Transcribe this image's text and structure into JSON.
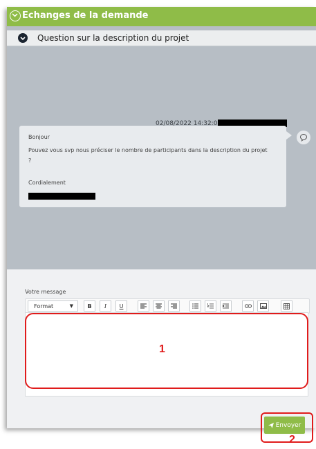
{
  "header": {
    "title": "Echanges de la demande",
    "expand_icon": "chevron-down-icon"
  },
  "subheader": {
    "title": "Question sur la description du projet",
    "toggle_icon": "collapse-icon"
  },
  "message": {
    "timestamp": "02/08/2022 14:32:02 -",
    "greeting": "Bonjour",
    "body_line1": "Pouvez vous svp nous préciser le nombre de participants dans la description du projet",
    "body_line2": "?",
    "closing": "Cordialement",
    "reply_icon": "speech-bubble-icon"
  },
  "compose": {
    "label": "Votre message",
    "format_select": "Format",
    "toolbar_buttons": {
      "bold": "B",
      "italic": "I",
      "underline": "U"
    },
    "send_label": "Envoyer",
    "send_icon": "paper-plane-icon"
  },
  "annotations": {
    "editor_number": "1",
    "send_number": "2"
  },
  "colors": {
    "accent_green": "#8fbc48",
    "annotation_red": "#e01b1b",
    "panel_gray": "#b7bec5"
  }
}
